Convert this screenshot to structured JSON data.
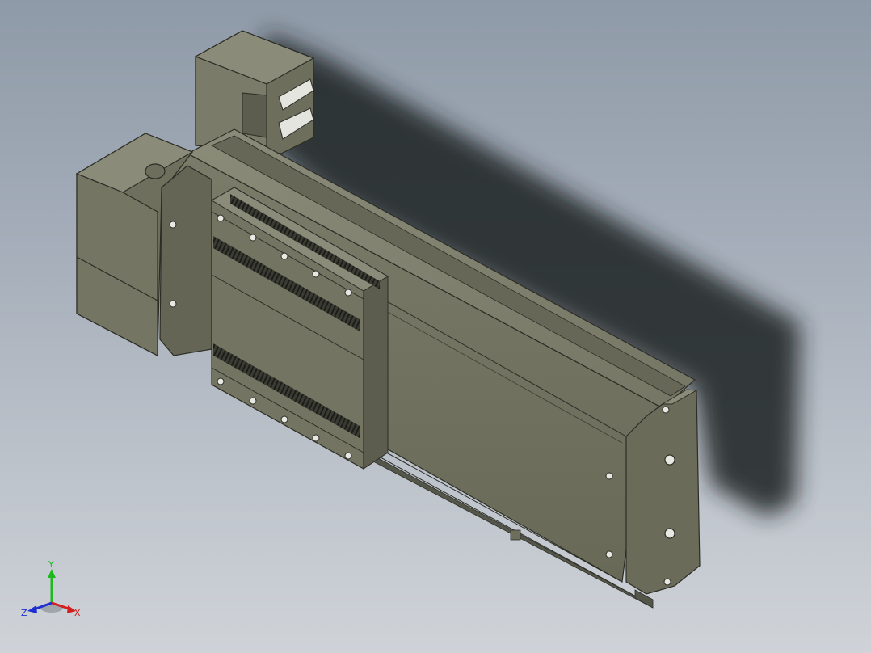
{
  "viewport": {
    "background_top": "#8f9aa8",
    "background_bottom": "#cfd3d8",
    "model_color": "#6f705f",
    "model_dark": "#4d4e42",
    "model_light": "#8a8b78",
    "shadow_color": "#1e2124"
  },
  "triad": {
    "x_label": "X",
    "y_label": "Y",
    "z_label": "Z",
    "x_color": "#d21e1e",
    "y_color": "#1fb81f",
    "z_color": "#1e2ed2"
  }
}
